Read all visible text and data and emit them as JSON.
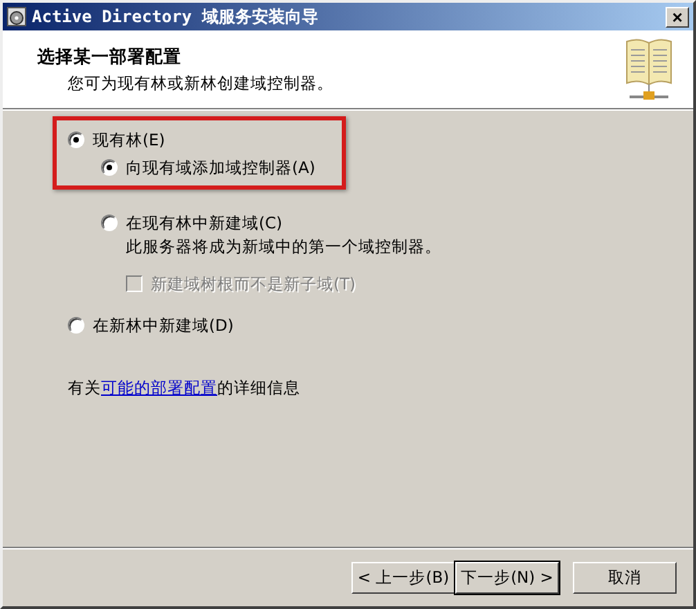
{
  "window": {
    "title": "Active Directory 域服务安装向导",
    "close": "×"
  },
  "header": {
    "title": "选择某一部署配置",
    "subtitle": "您可为现有林或新林创建域控制器。"
  },
  "options": [
    {
      "kind": "radio",
      "label": "现有林(E)",
      "selected": true,
      "children": [
        {
          "kind": "radio",
          "label": "向现有域添加域控制器(A)",
          "selected": true
        },
        {
          "kind": "radio",
          "label": "在现有林中新建域(C)",
          "selected": false,
          "description": "此服务器将成为新域中的第一个域控制器。",
          "children": [
            {
              "kind": "checkbox",
              "label": "新建域树根而不是新子域(T)",
              "checked": false,
              "disabled": true
            }
          ]
        }
      ]
    },
    {
      "kind": "radio",
      "label": "在新林中新建域(D)",
      "selected": false
    }
  ],
  "annotation": {
    "kind": "highlight"
  },
  "info": {
    "before": "有关",
    "link": "可能的部署配置",
    "after": "的详细信息"
  },
  "buttons": [
    {
      "label": "< 上一步(B)",
      "default": false
    },
    {
      "label": "下一步(N) >",
      "default": true
    },
    {
      "label": "取消",
      "default": false
    }
  ]
}
